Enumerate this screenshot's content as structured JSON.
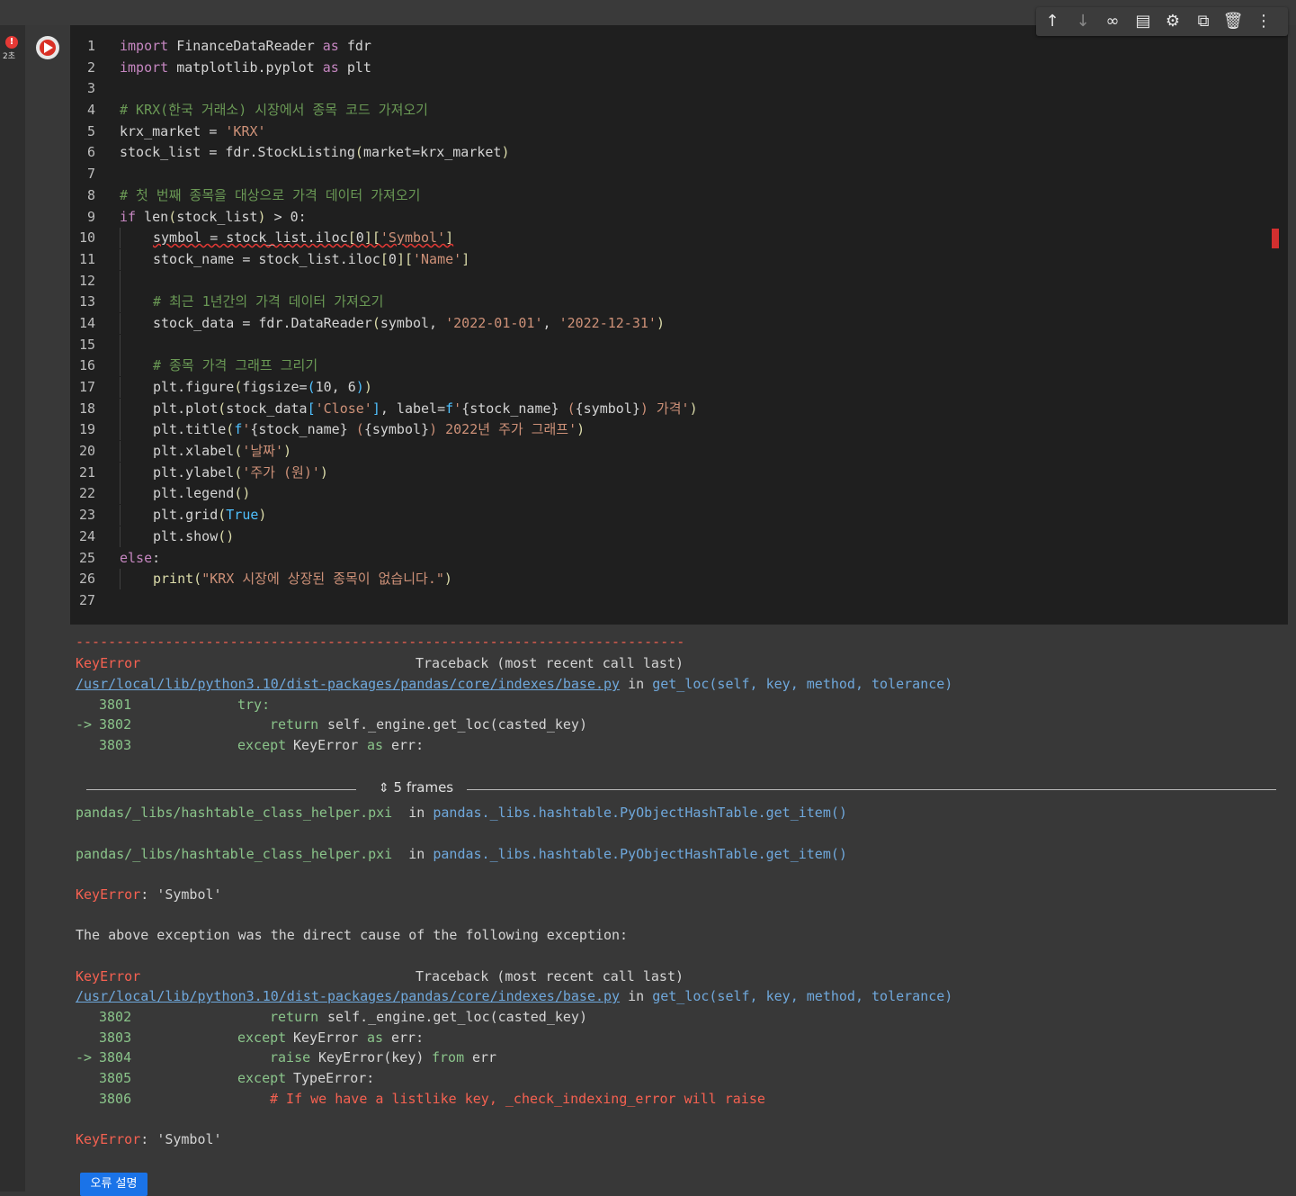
{
  "status": {
    "error_count": "!",
    "exec_time": "2초"
  },
  "toolbar": {
    "icons": [
      "arrow-up",
      "arrow-down",
      "link",
      "comment",
      "settings",
      "mirror",
      "delete",
      "more"
    ]
  },
  "code_lines": [
    "import FinanceDataReader as fdr",
    "import matplotlib.pyplot as plt",
    "",
    "# KRX(한국 거래소) 시장에서 종목 코드 가져오기",
    "krx_market = 'KRX'",
    "stock_list = fdr.StockListing(market=krx_market)",
    "",
    "# 첫 번째 종목을 대상으로 가격 데이터 가져오기",
    "if len(stock_list) > 0:",
    "    symbol = stock_list.iloc[0]['Symbol']",
    "    stock_name = stock_list.iloc[0]['Name']",
    "",
    "    # 최근 1년간의 가격 데이터 가져오기",
    "    stock_data = fdr.DataReader(symbol, '2022-01-01', '2022-12-31')",
    "",
    "    # 종목 가격 그래프 그리기",
    "    plt.figure(figsize=(10, 6))",
    "    plt.plot(stock_data['Close'], label=f'{stock_name} ({symbol}) 가격')",
    "    plt.title(f'{stock_name} ({symbol}) 2022년 주가 그래프')",
    "    plt.xlabel('날짜')",
    "    plt.ylabel('주가 (원)')",
    "    plt.legend()",
    "    plt.grid(True)",
    "    plt.show()",
    "else:",
    "    print(\"KRX 시장에 상장된 종목이 없습니다.\")",
    ""
  ],
  "output": {
    "dashes": "---------------------------------------------------------------------------",
    "err1_type": "KeyError",
    "tb_header": "Traceback (most recent call last)",
    "path": "/usr/local/lib/python3.10/dist-packages/pandas/core/indexes/base.py",
    "in_word": "in",
    "func_sig": "get_loc(self, key, method, tolerance)",
    "b1_l1_no": "3801",
    "b1_l1_code": "try:",
    "b1_l2_arrow": "->",
    "b1_l2_no": "3802",
    "b1_l2_kw": "return",
    "b1_l2_code": "self._engine.get_loc(casted_key)",
    "b1_l3_no": "3803",
    "b1_l3_kw": "except",
    "b1_l3_code": "KeyError",
    "b1_l3_as": "as",
    "b1_l3_err": "err:",
    "frames_label": "5 frames",
    "pxi_file": "pandas/_libs/hashtable_class_helper.pxi",
    "pxi_func": "pandas._libs.hashtable.PyObjectHashTable.get_item()",
    "keyerror_msg": "'Symbol'",
    "cause_text": "The above exception was the direct cause of the following exception:",
    "b2_l1_no": "3802",
    "b2_l1_kw": "return",
    "b2_l1_code": "self._engine.get_loc(casted_key)",
    "b2_l2_no": "3803",
    "b2_l2_kw": "except",
    "b2_l2_code": "KeyError",
    "b2_l2_as": "as",
    "b2_l2_err": "err:",
    "b2_l3_arrow": "->",
    "b2_l3_no": "3804",
    "b2_l3_kw": "raise",
    "b2_l3_code": "KeyError(key)",
    "b2_l3_from": "from",
    "b2_l3_err": "err",
    "b2_l4_no": "3805",
    "b2_l4_kw": "except",
    "b2_l4_code": "TypeError:",
    "b2_l5_no": "3806",
    "b2_l5_comment": "# If we have a listlike key, _check_indexing_error will raise",
    "final_type": "KeyError",
    "final_msg": "'Symbol'",
    "explain_button": "오류 설명"
  }
}
